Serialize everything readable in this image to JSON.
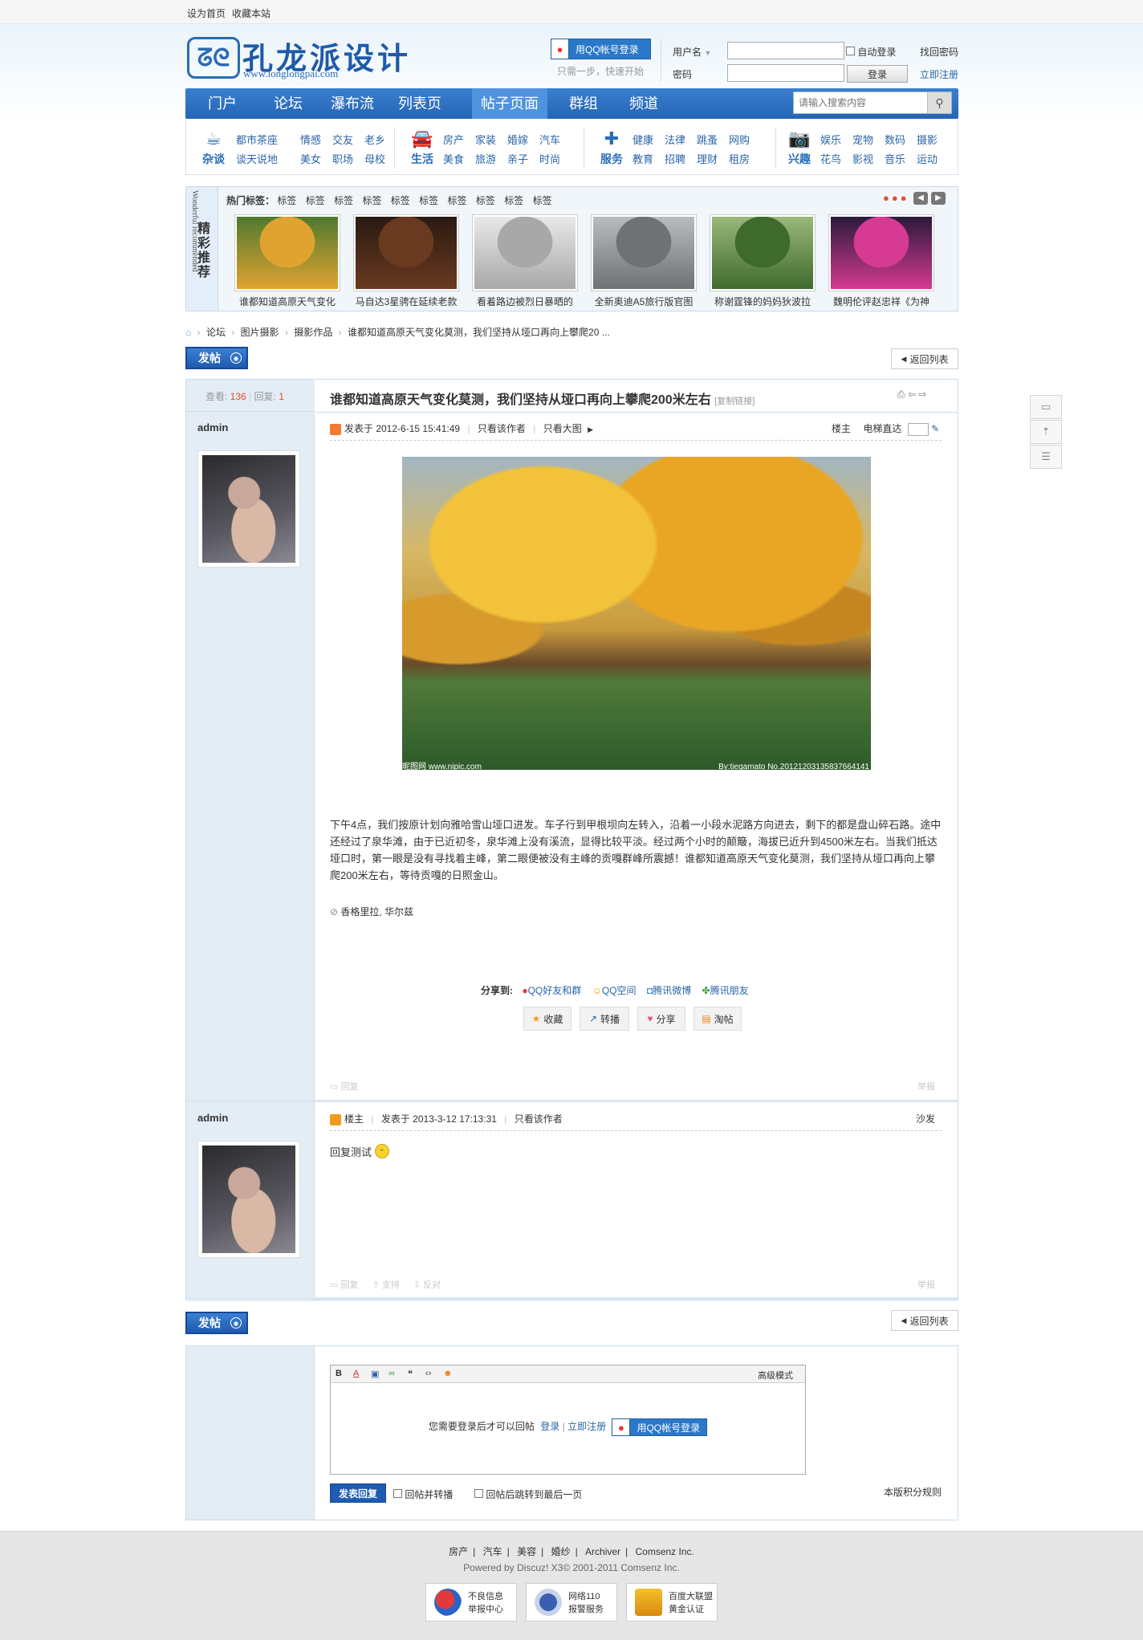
{
  "topbar": {
    "set_home": "设为首页",
    "bookmark": "收藏本站"
  },
  "header": {
    "logo_mark": "ᘔᘓ",
    "logo_text": "孔龙派设计",
    "logo_url": "www.longlongpai.com",
    "qq_login": "用QQ帐号登录",
    "qq_hint": "只需一步，快速开始",
    "username_label": "用户名",
    "password_label": "密码",
    "auto_login": "自动登录",
    "login_button": "登录",
    "find_password": "找回密码",
    "register": "立即注册"
  },
  "nav": {
    "items": [
      "门户",
      "论坛",
      "瀑布流",
      "列表页",
      "帖子页面",
      "群组",
      "频道"
    ],
    "active": "帖子页面",
    "search_placeholder": "请输入搜索内容"
  },
  "categories": [
    {
      "name": "杂谈",
      "links": [
        "都市茶座",
        "情感",
        "交友",
        "老乡",
        "谈天说地",
        "美女",
        "职场",
        "母校"
      ]
    },
    {
      "name": "生活",
      "links": [
        "房产",
        "家装",
        "婚嫁",
        "汽车",
        "美食",
        "旅游",
        "亲子",
        "时尚"
      ]
    },
    {
      "name": "服务",
      "links": [
        "健康",
        "法律",
        "跳蚤",
        "网购",
        "教育",
        "招聘",
        "理财",
        "租房"
      ]
    },
    {
      "name": "兴趣",
      "links": [
        "娱乐",
        "宠物",
        "数码",
        "摄影",
        "花鸟",
        "影视",
        "音乐",
        "运动"
      ]
    }
  ],
  "featured": {
    "side_title": "精彩推荐",
    "side_en": "Wonderful recommended",
    "hot_tags_label": "热门标签：",
    "tags": [
      "标签",
      "标签",
      "标签",
      "标签",
      "标签",
      "标签",
      "标签",
      "标签",
      "标签",
      "标签"
    ],
    "items": [
      {
        "caption": "谁都知道高原天气变化",
        "colors": [
          "#e0a330",
          "#4f7a2e"
        ]
      },
      {
        "caption": "马自达3星骋在延续老款",
        "colors": [
          "#6a3a20",
          "#2a1a12"
        ]
      },
      {
        "caption": "看着路边被烈日暴晒的",
        "colors": [
          "#a8a8a8",
          "#e8e8e8"
        ]
      },
      {
        "caption": "全新奥迪A5旅行版官图",
        "colors": [
          "#6e7275",
          "#b8bcbf"
        ]
      },
      {
        "caption": "称谢霆锋的妈妈狄波拉",
        "colors": [
          "#3f6a2e",
          "#9ab87a"
        ]
      },
      {
        "caption": "魏明伦评赵忠祥《为神",
        "colors": [
          "#d63a92",
          "#2a1a3a"
        ]
      }
    ]
  },
  "breadcrumb": [
    "论坛",
    "图片摄影",
    "摄影作品",
    "谁都知道高原天气变化莫测，我们坚持从垭口再向上攀爬20 ..."
  ],
  "buttons": {
    "post": "发帖",
    "back_to_list": "返回列表"
  },
  "thread": {
    "views_label": "查看:",
    "views": "136",
    "replies_label": "回复:",
    "replies": "1",
    "title": "谁都知道高原天气变化莫测，我们坚持从垭口再向上攀爬200米左右",
    "copy_link": "[复制链接]"
  },
  "post1": {
    "author": "admin",
    "posted": "发表于 2012-6-15 15:41:49",
    "only_author": "只看该作者",
    "big_image": "只看大图",
    "floor": "楼主",
    "elevator": "电梯直达",
    "image_caption": "昵图网 www.nipic.com",
    "image_caption_right": "By:tiegamato  No.20121203135837664141",
    "text": "下午4点，我们按原计划向雅哈雪山垭口进发。车子行到甲根坝向左转入，沿着一小段水泥路方向进去，剩下的都是盘山碎石路。途中还经过了泉华滩，由于已近初冬，泉华滩上没有溪流，显得比较平淡。经过两个小时的颠簸，海拔已近升到4500米左右。当我们抵达垭口时，第一眼是没有寻找着主峰，第二眼便被没有主峰的贡嘎群峰所震撼！谁都知道高原天气变化莫测，我们坚持从垭口再向上攀爬200米左右，等待贡嘎的日照金山。",
    "tags": "香格里拉, 华尔兹",
    "share_label": "分享到:",
    "share_targets": [
      "QQ好友和群",
      "QQ空间",
      "腾讯微博",
      "腾讯朋友"
    ],
    "actions": [
      "收藏",
      "转播",
      "分享",
      "淘帖"
    ],
    "reply": "回复",
    "report": "举报"
  },
  "post2": {
    "author": "admin",
    "floor_label": "楼主",
    "posted": "发表于 2013-3-12 17:13:31",
    "only_author": "只看该作者",
    "floor": "沙发",
    "text": "回复测试",
    "reply": "回复",
    "support": "支持",
    "oppose": "反对",
    "report": "举报"
  },
  "reply_form": {
    "advanced_mode": "高级模式",
    "need_login": "您需要登录后才可以回帖",
    "login": "登录",
    "register": "立即注册",
    "qq_login": "用QQ帐号登录",
    "submit": "发表回复",
    "opt_forward": "回帖并转播",
    "opt_jump": "回帖后跳转到最后一页",
    "credit_rules": "本版积分规则"
  },
  "footer": {
    "links": [
      "房产",
      "汽车",
      "美容",
      "婚纱",
      "Archiver",
      "Comsenz Inc."
    ],
    "powered": "Powered by Discuz! X3© 2001-2011 Comsenz Inc.",
    "badges": [
      {
        "l1": "不良信息",
        "l2": "举报中心"
      },
      {
        "l1": "网络110",
        "l2": "报警服务"
      },
      {
        "l1": "百度大联盟",
        "l2": "黄金认证"
      }
    ]
  }
}
